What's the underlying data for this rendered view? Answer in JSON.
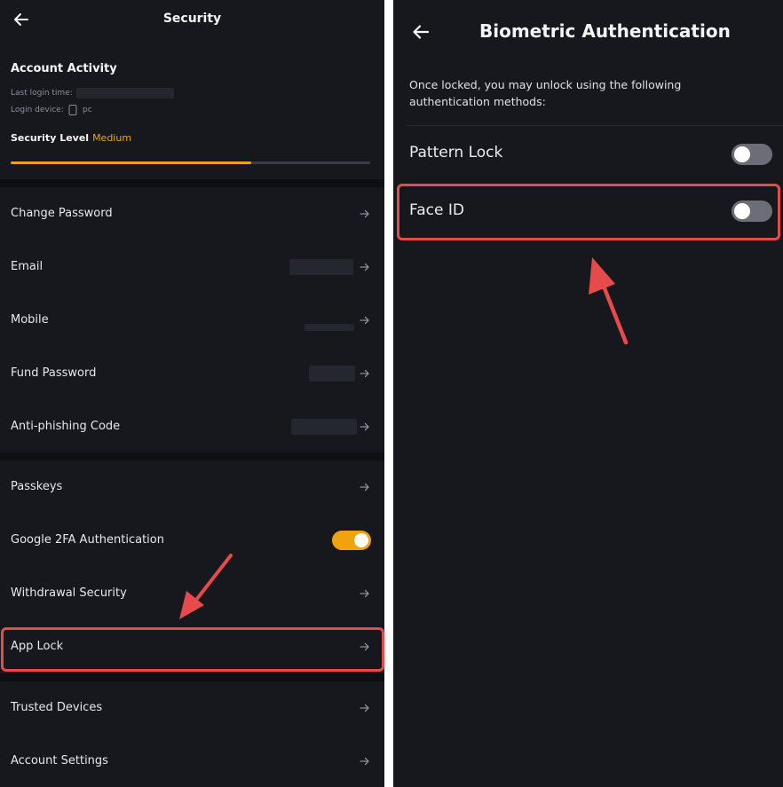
{
  "left": {
    "title": "Security",
    "account_activity": {
      "title": "Account Activity",
      "last_login_label": "Last login time:",
      "login_device_label": "Login device:",
      "login_device_value": "pc"
    },
    "security_level": {
      "label": "Security Level",
      "value": "Medium",
      "progress": 0.67
    },
    "group1": [
      {
        "label": "Change Password"
      },
      {
        "label": "Email"
      },
      {
        "label": "Mobile"
      },
      {
        "label": "Fund Password"
      },
      {
        "label": "Anti-phishing Code"
      }
    ],
    "group2": [
      {
        "label": "Passkeys"
      },
      {
        "label": "Google 2FA Authentication",
        "toggle_on": true
      },
      {
        "label": "Withdrawal Security"
      },
      {
        "label": "App Lock"
      }
    ],
    "group3": [
      {
        "label": "Trusted Devices"
      },
      {
        "label": "Account Settings"
      }
    ]
  },
  "right": {
    "title": "Biometric Authentication",
    "description": "Once locked, you may unlock using the following authentication methods:",
    "options": [
      {
        "label": "Pattern Lock",
        "toggle_on": false
      },
      {
        "label": "Face ID",
        "toggle_on": false
      }
    ]
  },
  "colors": {
    "background": "#17181e",
    "accent": "#f0a30f",
    "toggle_off": "#6b6e76",
    "highlight": "#e64a4a"
  },
  "icons": {
    "back": "arrow-left-icon",
    "row_arrow": "arrow-right-icon",
    "device": "phone-icon",
    "annotation": "pointer-arrow-icon"
  }
}
